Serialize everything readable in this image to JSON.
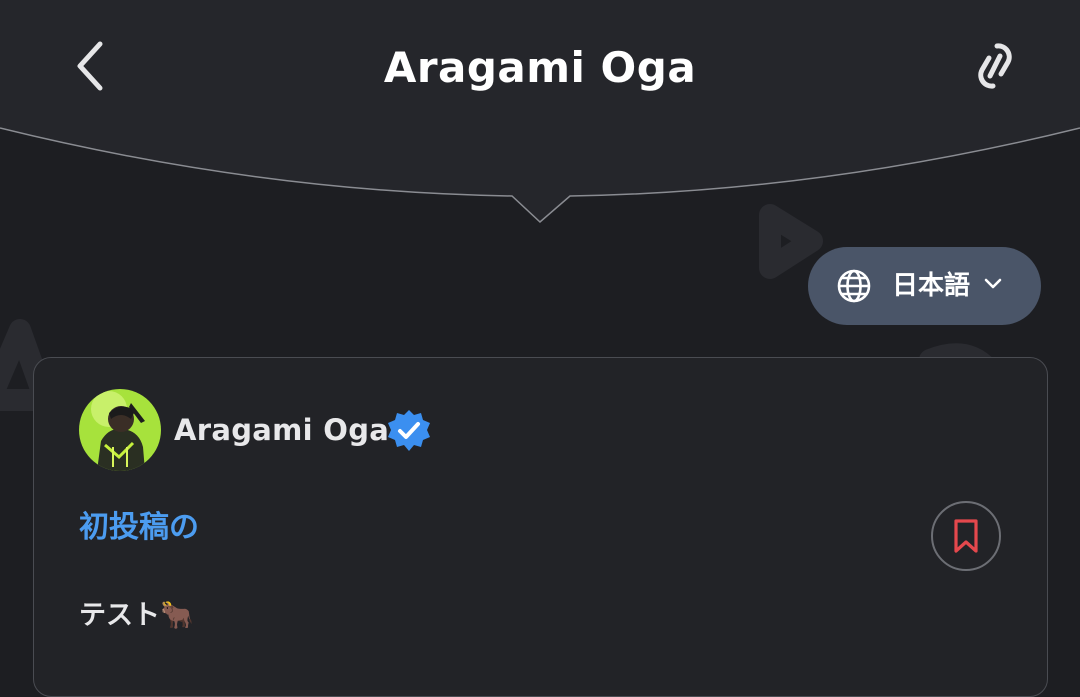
{
  "header": {
    "title": "Aragami Oga",
    "back_icon": "chevron-left-icon",
    "share_icon": "link-icon"
  },
  "language": {
    "label": "日本語",
    "icon": "globe-icon",
    "dropdown_icon": "chevron-down-icon"
  },
  "post": {
    "author": "Aragami Oga",
    "verified_icon": "verified-badge-icon",
    "title": "初投稿の",
    "body": "テスト🐂",
    "bookmark_icon": "bookmark-icon"
  },
  "colors": {
    "background": "#1d1e22",
    "header_bg": "#25262b",
    "accent_blue": "#4c9cf0",
    "bookmark_red": "#e5484d",
    "lang_pill": "#4a5568",
    "verified": "#3b8ff0"
  }
}
